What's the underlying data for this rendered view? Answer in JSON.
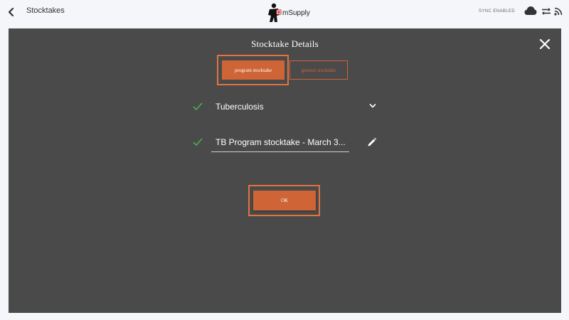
{
  "header": {
    "title": "Stocktakes",
    "logo_text": "mSupply",
    "sync_status": "SYNC ENABLED",
    "icons": [
      "back-arrow-icon",
      "cloud-icon",
      "swap-arrows-icon",
      "rss-icon"
    ]
  },
  "dialog": {
    "title": "Stocktake Details",
    "type_options": [
      {
        "label": "program stocktake",
        "selected": true
      },
      {
        "label": "general stocktake",
        "selected": false
      }
    ],
    "program": {
      "value": "Tuberculosis",
      "icons": [
        "check-icon",
        "chevron-down-icon"
      ]
    },
    "stocktake_name": {
      "value": "TB Program stocktake - March 3...",
      "icons": [
        "check-icon",
        "pencil-icon"
      ]
    },
    "ok_label": "OK"
  },
  "colors": {
    "accent": "#cf6437",
    "highlight": "#e0733f",
    "dialog_bg": "#4a4a4a",
    "page_bg": "#f4f6f9",
    "check_green": "#4caf50"
  }
}
